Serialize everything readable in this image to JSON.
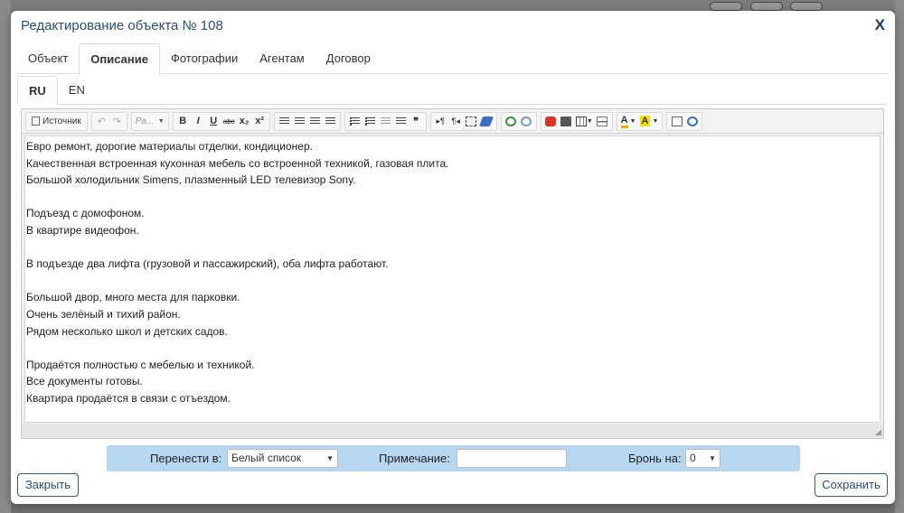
{
  "modal": {
    "title": "Редактирование объекта № 108",
    "close_glyph": "X"
  },
  "tabs": [
    {
      "label": "Объект",
      "active": false
    },
    {
      "label": "Описание",
      "active": true
    },
    {
      "label": "Фотографии",
      "active": false
    },
    {
      "label": "Агентам",
      "active": false
    },
    {
      "label": "Договор",
      "active": false
    }
  ],
  "lang_tabs": [
    {
      "label": "RU",
      "active": true
    },
    {
      "label": "EN",
      "active": false
    }
  ],
  "toolbar": {
    "source_label": "Источник",
    "paragraph_combo": "Ра...",
    "bold": "B",
    "italic": "I",
    "underline": "U",
    "strike": "abc",
    "subscript": "x₂",
    "superscript": "x²",
    "quote": "❞",
    "text_color": "A",
    "bg_color": "A"
  },
  "content_lines": [
    "Евро ремонт, дорогие материалы отделки, кондиционер.",
    "Качественная встроенная кухонная мебель со встроенной техникой, газовая плита.",
    "Большой холодильник Simens, плазменный LED телевизор Sony.",
    "",
    "Подъезд с домофоном.",
    "В квартире видеофон.",
    "",
    "В подъезде два лифта (грузовой и пассажирский), оба лифта работают.",
    "",
    "Большой двор, много места для парковки.",
    "Очень зелёный и тихий район.",
    "Рядом несколько школ и детских садов.",
    "",
    "Продаётся полностью с мебелью и техникой.",
    "Все документы готовы.",
    "Квартира продаётся в связи с отъездом."
  ],
  "form": {
    "move_label": "Перенести в:",
    "move_value": "Белый список",
    "note_label": "Примечание:",
    "note_value": "",
    "booking_label": "Бронь на:",
    "booking_value": "0"
  },
  "buttons": {
    "close_label": "Закрыть",
    "save_label": "Сохранить"
  },
  "colors": {
    "title": "#2a4e7a",
    "form_bar": "#b7d7f1",
    "button_border": "#2f5d8a"
  }
}
